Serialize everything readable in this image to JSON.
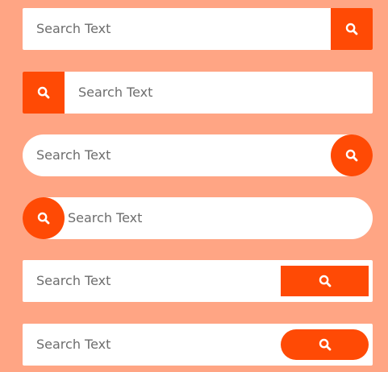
{
  "colors": {
    "background": "#ffa584",
    "accent": "#ff4a05",
    "field": "#ffffff",
    "placeholder": "#6d6d6d"
  },
  "icons": {
    "search": "search-icon"
  },
  "search_bars": [
    {
      "placeholder": "Search Text",
      "style": "square, button right"
    },
    {
      "placeholder": "Search Text",
      "style": "square, button left"
    },
    {
      "placeholder": "Search Text",
      "style": "pill, circular button right"
    },
    {
      "placeholder": "Search Text",
      "style": "pill, circular button left"
    },
    {
      "placeholder": "Search Text",
      "style": "square, inset rectangular button"
    },
    {
      "placeholder": "Search Text",
      "style": "square, inset pill button"
    }
  ]
}
